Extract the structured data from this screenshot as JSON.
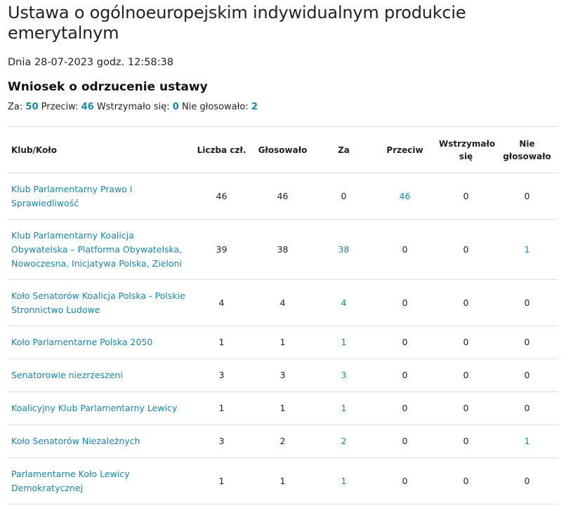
{
  "page": {
    "title": "Ustawa o ogólnoeuropejskim indywidualnym produkcie emerytalnym",
    "date_line": "Dnia 28-07-2023 godz. 12:58:38",
    "vote_title": "Wniosek o odrzucenie ustawy"
  },
  "summary": {
    "za_label": "Za:",
    "za": "50",
    "przeciw_label": "Przeciw:",
    "przeciw": "46",
    "wstrzymalo_label": "Wstrzymało się:",
    "wstrzymalo": "0",
    "nie_glosowalo_label": "Nie głosowało:",
    "nie_glosowalo": "2"
  },
  "table": {
    "headers": [
      "Klub/Koło",
      "Liczba czł.",
      "Głosowało",
      "Za",
      "Przeciw",
      "Wstrzymało się",
      "Nie głosowało"
    ],
    "rows": [
      {
        "club": "Klub Parlamentarny Prawo i Sprawiedliwość",
        "members": "46",
        "voted": "46",
        "za": "0",
        "przeciw": "46",
        "wstrzymalo": "0",
        "nie": "0",
        "links": {
          "za": false,
          "przeciw": true,
          "wstrzymalo": false,
          "nie": false
        }
      },
      {
        "club": "Klub Parlamentarny Koalicja Obywatelska – Platforma Obywatelska, Nowoczesna, Inicjatywa Polska, Zieloni",
        "members": "39",
        "voted": "38",
        "za": "38",
        "przeciw": "0",
        "wstrzymalo": "0",
        "nie": "1",
        "links": {
          "za": true,
          "przeciw": false,
          "wstrzymalo": false,
          "nie": true
        }
      },
      {
        "club": "Koło Senatorów Koalicja Polska - Polskie Stronnictwo Ludowe",
        "members": "4",
        "voted": "4",
        "za": "4",
        "przeciw": "0",
        "wstrzymalo": "0",
        "nie": "0",
        "links": {
          "za": true,
          "przeciw": false,
          "wstrzymalo": false,
          "nie": false
        }
      },
      {
        "club": "Koło Parlamentarne Polska 2050",
        "members": "1",
        "voted": "1",
        "za": "1",
        "przeciw": "0",
        "wstrzymalo": "0",
        "nie": "0",
        "links": {
          "za": true,
          "przeciw": false,
          "wstrzymalo": false,
          "nie": false
        }
      },
      {
        "club": "Senatorowie niezrzeszeni",
        "members": "3",
        "voted": "3",
        "za": "3",
        "przeciw": "0",
        "wstrzymalo": "0",
        "nie": "0",
        "links": {
          "za": true,
          "przeciw": false,
          "wstrzymalo": false,
          "nie": false
        }
      },
      {
        "club": "Koalicyjny Klub Parlamentarny Lewicy",
        "members": "1",
        "voted": "1",
        "za": "1",
        "przeciw": "0",
        "wstrzymalo": "0",
        "nie": "0",
        "links": {
          "za": true,
          "przeciw": false,
          "wstrzymalo": false,
          "nie": false
        }
      },
      {
        "club": "Koło Senatorów Niezależnych",
        "members": "3",
        "voted": "2",
        "za": "2",
        "przeciw": "0",
        "wstrzymalo": "0",
        "nie": "1",
        "links": {
          "za": true,
          "przeciw": false,
          "wstrzymalo": false,
          "nie": true
        }
      },
      {
        "club": "Parlamentarne Koło Lewicy Demokratycznej",
        "members": "1",
        "voted": "1",
        "za": "1",
        "przeciw": "0",
        "wstrzymalo": "0",
        "nie": "0",
        "links": {
          "za": true,
          "przeciw": false,
          "wstrzymalo": false,
          "nie": false
        }
      }
    ]
  },
  "colors": {
    "link": "#1a84a8",
    "border": "#dcdcdc",
    "text": "#222222"
  }
}
